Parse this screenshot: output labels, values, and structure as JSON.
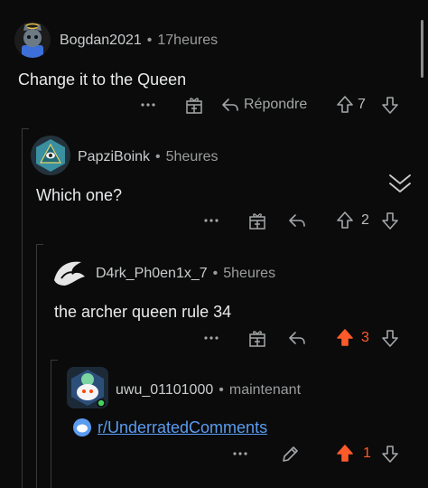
{
  "comments": [
    {
      "username": "Bogdan2021",
      "time": "17heures",
      "text": "Change it to the Queen",
      "reply_label": "Répondre",
      "votes": "7"
    },
    {
      "username": "PapziBoink",
      "time": "5heures",
      "text": "Which one?",
      "votes": "2"
    },
    {
      "username": "D4rk_Ph0en1x_7",
      "time": "5heures",
      "text": "the archer queen rule 34",
      "votes": "3"
    },
    {
      "username": "uwu_01101000",
      "time": "maintenant",
      "link_text": "r/UnderratedComments",
      "votes": "1"
    }
  ],
  "separator": "•",
  "colors": {
    "background": "#0b0b0b",
    "upvote_active": "#ff5a2a",
    "link": "#5a9cf0"
  }
}
